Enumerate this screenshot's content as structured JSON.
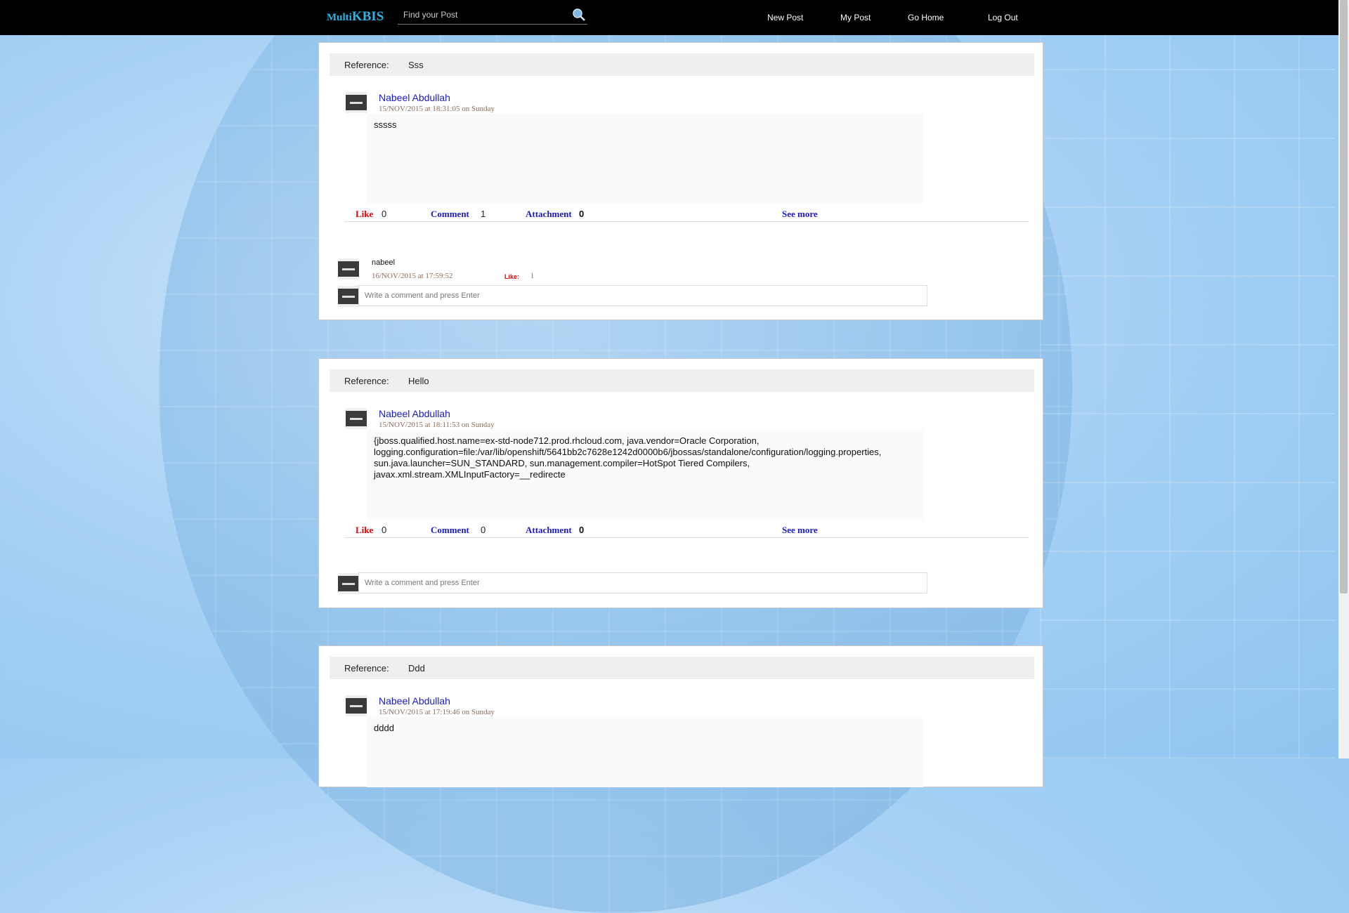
{
  "header": {
    "logo_small": "Multi",
    "logo_big": "KBIS",
    "search_placeholder": "Find your Post",
    "nav": [
      "New Post",
      "My Post",
      "Go Home",
      "Log Out"
    ]
  },
  "reference_label": "Reference:",
  "comment_placeholder": "Write a comment and press Enter",
  "labels": {
    "like": "Like",
    "comment": "Comment",
    "attachment": "Attachment",
    "see_more": "See more",
    "comment_like": "Like:"
  },
  "posts": [
    {
      "reference": "Sss",
      "author": "Nabeel Abdullah",
      "date": "15/NOV/2015 at 18:31:05 on Sunday",
      "body": "sssss",
      "likes": "0",
      "comments": "1",
      "attachments": "0",
      "comment": {
        "user": "nabeel",
        "date": "16/NOV/2015 at 17:59:52",
        "likes": "1"
      }
    },
    {
      "reference": "Hello",
      "author": "Nabeel Abdullah",
      "date": "15/NOV/2015 at 18:11:53 on Sunday",
      "body": "{jboss.qualified.host.name=ex-std-node712.prod.rhcloud.com, java.vendor=Oracle Corporation, logging.configuration=file:/var/lib/openshift/5641bb2c7628e1242d0000b6/jbossas/standalone/configuration/logging.properties, sun.java.launcher=SUN_STANDARD, sun.management.compiler=HotSpot Tiered Compilers, javax.xml.stream.XMLInputFactory=__redirecte",
      "likes": "0",
      "comments": "0",
      "attachments": "0"
    },
    {
      "reference": "Ddd",
      "author": "Nabeel Abdullah",
      "date": "15/NOV/2015 at 17:19:46 on Sunday",
      "body": "dddd"
    }
  ],
  "colors": {
    "topbar": "#000000",
    "logo": "#2bb5e6",
    "author": "#1a1acc",
    "like": "#ee0000"
  }
}
